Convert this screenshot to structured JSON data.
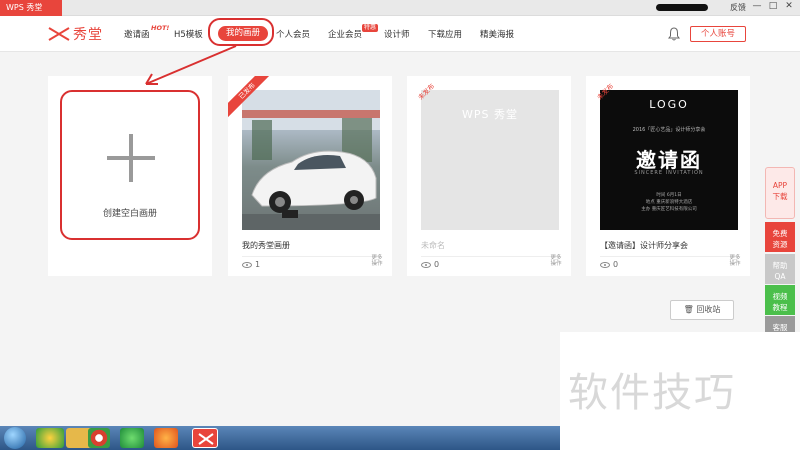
{
  "titlebar": {
    "app_title": "WPS 秀堂",
    "feedback": "反馈",
    "minimize": "—",
    "maximize": "□",
    "close": "✕"
  },
  "nav": {
    "logo_text": "秀堂",
    "items": [
      "邀请函",
      "H5模板",
      "我的画册",
      "个人会员",
      "企业会员",
      "设计师",
      "下载应用",
      "精美海报"
    ],
    "hot_badge": "HOT!",
    "tejia_badge": "特惠",
    "account_button": "个人账号"
  },
  "cards": {
    "create": {
      "label": "创建空白画册"
    },
    "items": [
      {
        "title": "我的秀堂画册",
        "views": "1",
        "status": "已发布",
        "more": "更多操作"
      },
      {
        "title": "未命名",
        "views": "0",
        "status": "未发布",
        "more": "更多操作",
        "watermark": "WPS 秀堂"
      },
      {
        "title": "【邀请函】设计师分享会",
        "views": "0",
        "status": "未发布",
        "more": "更多操作"
      }
    ]
  },
  "invite_thumb": {
    "logo": "LOGO",
    "subtitle": "2016「匠心艺品」设计师分享会",
    "main": "邀请函",
    "english": "SINCERE INVITATION",
    "info": [
      "时间 6月1日",
      "地点 重庆新浪特大酒店",
      "主办 重庆匠艺科技有限公司"
    ]
  },
  "recycle_bin": "回收站",
  "float_bar": {
    "app_download": [
      "APP",
      "下载"
    ],
    "free_resources": [
      "免费",
      "资源"
    ],
    "help_qa": [
      "帮助",
      "QA"
    ],
    "video_tutorial": [
      "视频",
      "教程"
    ],
    "customer_service": [
      "客服"
    ]
  },
  "watermark": "软件技巧",
  "colors": {
    "accent": "#e8453c",
    "annotation": "#d93030",
    "background": "#f4f4f4"
  }
}
